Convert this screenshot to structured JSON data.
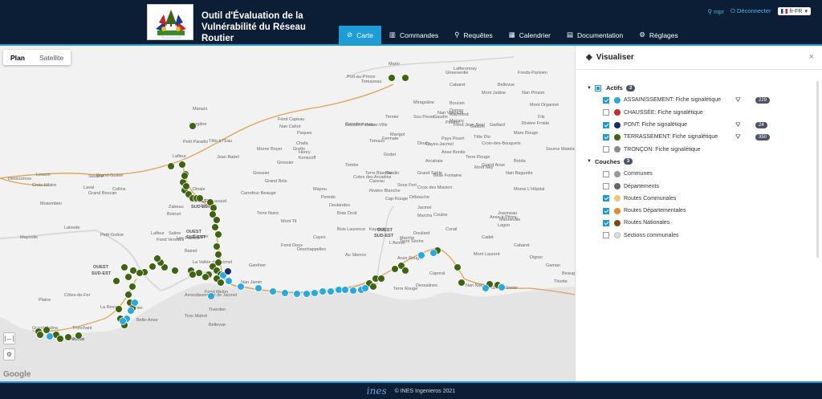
{
  "header": {
    "title": "Outil d'Évaluation de la Vulnérabilité du Réseau Routier",
    "user": "mpr",
    "logout": "Déconnecter",
    "language": "fr-FR"
  },
  "nav": [
    {
      "label": "Carte",
      "icon": "compass-icon",
      "active": true
    },
    {
      "label": "Commandes",
      "icon": "bar-chart-icon"
    },
    {
      "label": "Requêtes",
      "icon": "search-icon"
    },
    {
      "label": "Calendrier",
      "icon": "calendar-icon"
    },
    {
      "label": "Documentation",
      "icon": "book-icon"
    },
    {
      "label": "Réglages",
      "icon": "gear-icon"
    }
  ],
  "map": {
    "type_plan": "Plan",
    "type_satellite": "Satellite",
    "attribution": "Google",
    "places": [
      "Port-au-Prince",
      "Carrefour",
      "Pétion-Ville",
      "Marin",
      "Mariani",
      "Léogâne",
      "Petit Paradis",
      "Lafleur",
      "Laval",
      "Dinale",
      "Gressier",
      "Fond Capeau",
      "Henry",
      "Chafa",
      "Kenscoff",
      "Godet",
      "Fermate",
      "Jacmel",
      "Marigot",
      "Cayes-Jacmel",
      "Belle Fontaine",
      "Tête Dlo",
      "Mont Ney",
      "Raymond",
      "Grand-Goâve",
      "Petit-Goâve",
      "Lafleur",
      "Fond Verettes",
      "Zabeau",
      "Ka Dadi",
      "Bainet",
      "La Vallée de Jacmel",
      "Lavaud",
      "Terre Rouge",
      "Marche",
      "Cap-Rouge",
      "Dessalines",
      "Mont Laurent",
      "Caporal",
      "Nan Naël",
      "Grand Gosier",
      "Anse-à-Pitres",
      "Thiotte",
      "Belle-Anse",
      "Trou Mahot",
      "Tronchant",
      "Grand Salina",
      "Boutin",
      "Dumont",
      "La Revoir",
      "Gomier",
      "Côtes-de-Fer",
      "Plaine",
      "Dessources",
      "Lesson",
      "Croix-Hilaire",
      "Savane",
      "Colline",
      "Grand Boucan",
      "Mosembier",
      "Maynolle",
      "Lalonde",
      "Botouri",
      "Les Palmes",
      "Cormier",
      "Saline",
      "Nan Jamin",
      "Arrondissement de Jacmel",
      "Fond Melon",
      "Tiverdier",
      "Bellevue",
      "Terre Noire",
      "Bras Droit",
      "Au Silence",
      "L'Aviron",
      "Anse Rouge",
      "Terre Sèche",
      "Marcha",
      "Pèlerin",
      "Rivière Froide",
      "Fonds-Parisien",
      "Mare Rouge",
      "Cabaret",
      "Boucan",
      "Pays Pourri",
      "Anse Bonite",
      "Rivière Blanche",
      "Dumay",
      "Gaston",
      "Gaillard",
      "Grand Anse",
      "Lafferonnay",
      "Tomazeau",
      "Miragoâne",
      "Nan Valencia",
      "Arcahaie",
      "Croix-des-Bouquets",
      "Croix des Mission",
      "Cazeau",
      "Gheeverdie",
      "Bellevue",
      "Nan Pinson",
      "Mont Organisé",
      "Fils",
      "Mont Jadine",
      "Source Matelas",
      "Joanneau",
      "Manneville",
      "Lagon",
      "Coulne",
      "Boucan Peintre",
      "Grefin",
      "Paques",
      "Nan Cahot",
      "Tombe",
      "Terre Blanche",
      "Bandin",
      "Sous Fort",
      "Mapou",
      "Peredo",
      "Deslandes",
      "Cotes des Arcadins",
      "Tomazo",
      "Grand Sable",
      "Terre Rouge",
      "Nan Baguette",
      "Morne Boyer",
      "Débouche",
      "Grand Bois",
      "Mont Tit",
      "Ganthier",
      "Fond Doux",
      "Deschappelles",
      "Cayes",
      "Bois Laurence",
      "Kaydad",
      "Douilard",
      "Corail",
      "Cadet",
      "Cabaret",
      "Digner",
      "Gaman",
      "Beauge",
      "Carrefour Beauge",
      "Gressier",
      "Jean Rabel",
      "Tête à l'Eau",
      "Bréda",
      "Morne L'Hôpital",
      "Dinaly",
      "Ternier",
      "Sou Pesse",
      "Gaudin",
      "Macary",
      "Fond Jean Noel",
      "Pichon",
      "Lebrun",
      "Clarene"
    ],
    "region_labels": [
      "OUEST",
      "SUD-EST",
      "OUEST",
      "SUD-EST",
      "OUEST",
      "SUD-EST",
      "OUEST",
      "SUD-EST"
    ],
    "colors": {
      "green": "#3f6411",
      "blue": "#29a9e0",
      "road": "#e0a24e"
    },
    "controls": [
      "ruler-icon",
      "gear-icon"
    ]
  },
  "panel": {
    "title": "Visualiser",
    "close": "×",
    "groups": [
      {
        "label": "Actifs",
        "count": "3",
        "state": "partial",
        "items": [
          {
            "label": "ASSAINISSEMENT: Fiche signalétique",
            "checked": true,
            "color": "#29a9e0",
            "filter": true,
            "badge": "229"
          },
          {
            "label": "CHAUSSÉE: Fiche signalétique",
            "checked": false,
            "color": "#cc2b2b",
            "filter": false,
            "badge": ""
          },
          {
            "label": "PONT: Fiche signalétique",
            "checked": true,
            "color": "#1a2d6b",
            "filter": true,
            "badge": "24"
          },
          {
            "label": "TERRASSEMENT: Fiche signalétique",
            "checked": true,
            "color": "#3f6411",
            "filter": true,
            "badge": "350"
          },
          {
            "label": "TRONÇON: Fiche signalétique",
            "checked": false,
            "color": "#8a8a8a",
            "filter": false,
            "badge": ""
          }
        ]
      },
      {
        "label": "Couches",
        "count": "3",
        "state": "none",
        "items": [
          {
            "label": "Communes",
            "checked": false,
            "color": "#9a9a9a"
          },
          {
            "label": "Départements",
            "checked": false,
            "color": "#666666"
          },
          {
            "label": "Routes Communales",
            "checked": true,
            "color": "#f2c57a"
          },
          {
            "label": "Routes Départementales",
            "checked": true,
            "color": "#e08a2c"
          },
          {
            "label": "Routes Nationales",
            "checked": true,
            "color": "#7a4a1a"
          },
          {
            "label": "Sections communales",
            "checked": false,
            "color": "#dcdcdc"
          }
        ]
      }
    ]
  },
  "footer": {
    "brand": "ines",
    "copyright": "© INES Ingenieros 2021"
  }
}
